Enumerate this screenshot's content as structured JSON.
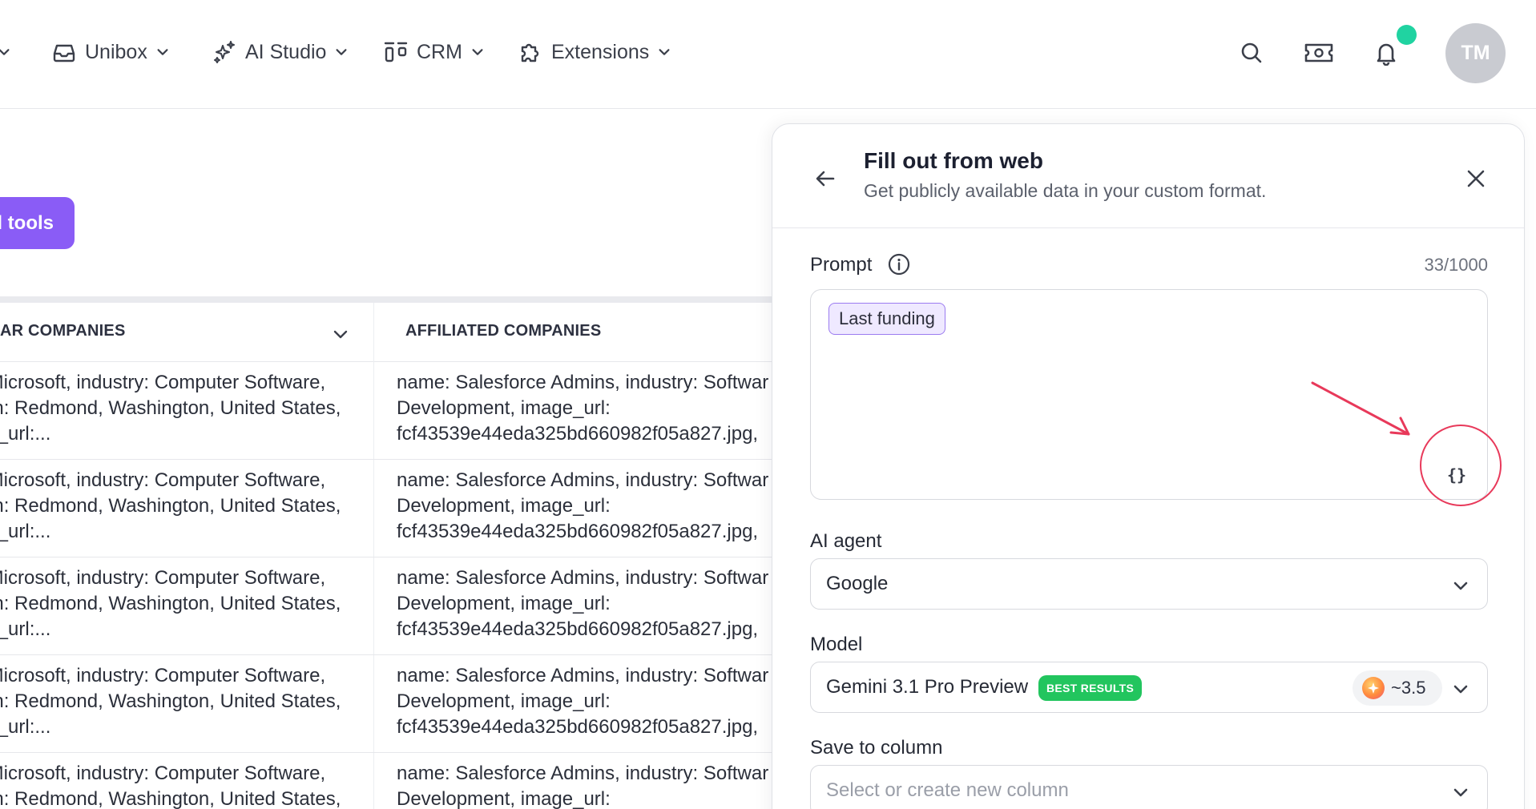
{
  "nav": {
    "items": [
      {
        "label": "Unibox",
        "icon": "inbox-icon"
      },
      {
        "label": "AI Studio",
        "icon": "sparkles-icon"
      },
      {
        "label": "CRM",
        "icon": "crm-columns-icon"
      },
      {
        "label": "Extensions",
        "icon": "puzzle-icon"
      }
    ],
    "avatar_initials": "TM"
  },
  "toolbar": {
    "tools_label": "l tools"
  },
  "table": {
    "headers": [
      "AR COMPANIES",
      "AFFILIATED COMPANIES"
    ],
    "rows": [
      {
        "a": " Microsoft, industry: Computer Software,\non: Redmond, Washington, United States,\nin_url:...",
        "b": "name: Salesforce Admins, industry: Softwar\nDevelopment, image_url:\nfcf43539e44eda325bd660982f05a827.jpg,"
      },
      {
        "a": " Microsoft, industry: Computer Software,\non: Redmond, Washington, United States,\nin_url:...",
        "b": "name: Salesforce Admins, industry: Softwar\nDevelopment, image_url:\nfcf43539e44eda325bd660982f05a827.jpg,"
      },
      {
        "a": " Microsoft, industry: Computer Software,\non: Redmond, Washington, United States,\nin_url:...",
        "b": "name: Salesforce Admins, industry: Softwar\nDevelopment, image_url:\nfcf43539e44eda325bd660982f05a827.jpg,"
      },
      {
        "a": " Microsoft, industry: Computer Software,\non: Redmond, Washington, United States,\nin_url:...",
        "b": "name: Salesforce Admins, industry: Softwar\nDevelopment, image_url:\nfcf43539e44eda325bd660982f05a827.jpg,"
      },
      {
        "a": " Microsoft, industry: Computer Software,\non: Redmond, Washington, United States,",
        "b": "name: Salesforce Admins, industry: Softwar\nDevelopment, image_url:"
      }
    ]
  },
  "panel": {
    "title": "Fill out from web",
    "subtitle": "Get publicly available data in your custom format.",
    "prompt": {
      "label": "Prompt",
      "counter": "33/1000",
      "chip": "Last funding",
      "variable_button": "{}"
    },
    "ai_agent": {
      "label": "AI agent",
      "value": "Google"
    },
    "model": {
      "label": "Model",
      "value": "Gemini 3.1 Pro Preview",
      "badge": "BEST RESULTS",
      "cost": "~3.5"
    },
    "save_to_column": {
      "label": "Save to column",
      "placeholder": "Select or create new column"
    }
  },
  "colors": {
    "accent_purple": "#8a5cf6",
    "notification_dot": "#20d3a1",
    "annotation_red": "#e8395a",
    "badge_green": "#22c55e"
  }
}
